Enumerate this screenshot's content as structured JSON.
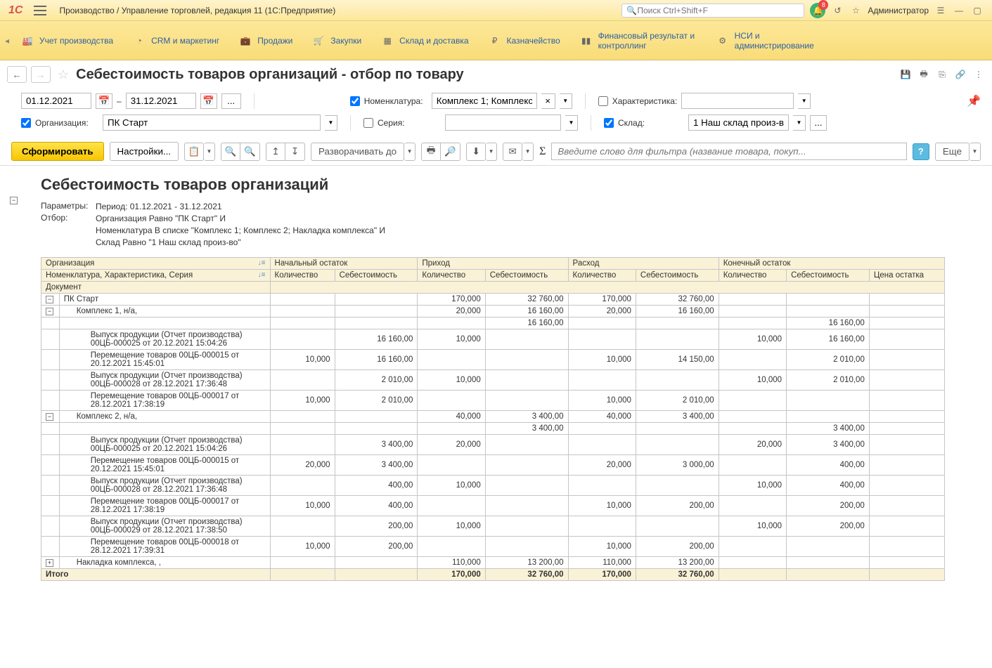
{
  "app": {
    "logo": "1C",
    "title": "Производство / Управление торговлей, редакция 11  (1С:Предприятие)",
    "search_placeholder": "Поиск Ctrl+Shift+F",
    "notification_count": "8",
    "user": "Администратор"
  },
  "sections": [
    {
      "label": "Учет производства"
    },
    {
      "label": "CRM и маркетинг"
    },
    {
      "label": "Продажи"
    },
    {
      "label": "Закупки"
    },
    {
      "label": "Склад и доставка"
    },
    {
      "label": "Казначейство"
    },
    {
      "label": "Финансовый результат и контроллинг"
    },
    {
      "label": "НСИ и администрирование"
    }
  ],
  "page": {
    "title": "Себестоимость товаров организаций - отбор по товару"
  },
  "filters": {
    "date_from": "01.12.2021",
    "date_sep": "–",
    "date_to": "31.12.2021",
    "dots": "...",
    "nomenclature_label": "Номенклатура:",
    "nomenclature_value": "Комплекс 1; Комплекс",
    "characteristic_label": "Характеристика:",
    "org_label": "Организация:",
    "org_value": "ПК Старт",
    "series_label": "Серия:",
    "warehouse_label": "Склад:",
    "warehouse_value": "1 Наш склад произ-во",
    "wh_dots": "..."
  },
  "toolbar": {
    "form": "Сформировать",
    "settings": "Настройки...",
    "expand_to": "Разворачивать до",
    "filter_placeholder": "Введите слово для фильтра (название товара, покуп...",
    "more": "Еще",
    "help": "?"
  },
  "report": {
    "title": "Себестоимость товаров организаций",
    "params_label": "Параметры:",
    "filter_label": "Отбор:",
    "params_line": "Период: 01.12.2021 - 31.12.2021",
    "filter_l1": "Организация Равно \"ПК Старт\" И",
    "filter_l2": "Номенклатура В списке \"Комплекс 1; Комплекс 2; Накладка комплекса\" И",
    "filter_l3": "Склад Равно \"1 Наш склад произ-во\""
  },
  "cols": {
    "h1_org": "Организация",
    "h1_begin": "Начальный остаток",
    "h1_in": "Приход",
    "h1_out": "Расход",
    "h1_end": "Конечный остаток",
    "h2_nomen": "Номенклатура, Характеристика, Серия",
    "h2_qty": "Количество",
    "h2_cost": "Себестоимость",
    "h2_price": "Цена остатка",
    "h3_doc": "Документ"
  },
  "rows": [
    {
      "lvl": 0,
      "toggle": "-",
      "name": "ПК Старт",
      "in_q": "170,000",
      "in_c": "32 760,00",
      "out_q": "170,000",
      "out_c": "32 760,00"
    },
    {
      "lvl": 1,
      "toggle": "-",
      "name": "Комплекс 1, н/а,",
      "in_q": "20,000",
      "in_c": "16 160,00",
      "out_q": "20,000",
      "out_c": "16 160,00"
    },
    {
      "lvl": 2,
      "name": "",
      "in_c": "16 160,00",
      "end_c": "16 160,00"
    },
    {
      "lvl": 2,
      "name": "Выпуск продукции (Отчет производства) 00ЦБ-000025 от 20.12.2021 15:04:26",
      "b_c": "16 160,00",
      "in_q": "10,000",
      "end_q": "10,000",
      "end_c": "16 160,00"
    },
    {
      "lvl": 2,
      "name": "Перемещение товаров 00ЦБ-000015 от 20.12.2021 15:45:01",
      "b_q": "10,000",
      "b_c": "16 160,00",
      "out_q": "10,000",
      "out_c": "14 150,00",
      "end_c": "2 010,00"
    },
    {
      "lvl": 2,
      "name": "Выпуск продукции (Отчет производства) 00ЦБ-000028 от 28.12.2021 17:36:48",
      "b_c": "2 010,00",
      "in_q": "10,000",
      "end_q": "10,000",
      "end_c": "2 010,00"
    },
    {
      "lvl": 2,
      "name": "Перемещение товаров 00ЦБ-000017 от 28.12.2021 17:38:19",
      "b_q": "10,000",
      "b_c": "2 010,00",
      "out_q": "10,000",
      "out_c": "2 010,00"
    },
    {
      "lvl": 1,
      "toggle": "-",
      "name": "Комплекс 2, н/а,",
      "in_q": "40,000",
      "in_c": "3 400,00",
      "out_q": "40,000",
      "out_c": "3 400,00"
    },
    {
      "lvl": 2,
      "name": "",
      "in_c": "3 400,00",
      "end_c": "3 400,00"
    },
    {
      "lvl": 2,
      "name": "Выпуск продукции (Отчет производства) 00ЦБ-000025 от 20.12.2021 15:04:26",
      "b_c": "3 400,00",
      "in_q": "20,000",
      "end_q": "20,000",
      "end_c": "3 400,00"
    },
    {
      "lvl": 2,
      "name": "Перемещение товаров 00ЦБ-000015 от 20.12.2021 15:45:01",
      "b_q": "20,000",
      "b_c": "3 400,00",
      "out_q": "20,000",
      "out_c": "3 000,00",
      "end_c": "400,00"
    },
    {
      "lvl": 2,
      "name": "Выпуск продукции (Отчет производства) 00ЦБ-000028 от 28.12.2021 17:36:48",
      "b_c": "400,00",
      "in_q": "10,000",
      "end_q": "10,000",
      "end_c": "400,00"
    },
    {
      "lvl": 2,
      "name": "Перемещение товаров 00ЦБ-000017 от 28.12.2021 17:38:19",
      "b_q": "10,000",
      "b_c": "400,00",
      "out_q": "10,000",
      "out_c": "200,00",
      "end_c": "200,00"
    },
    {
      "lvl": 2,
      "name": "Выпуск продукции (Отчет производства) 00ЦБ-000029 от 28.12.2021 17:38:50",
      "b_c": "200,00",
      "in_q": "10,000",
      "end_q": "10,000",
      "end_c": "200,00"
    },
    {
      "lvl": 2,
      "name": "Перемещение товаров 00ЦБ-000018 от 28.12.2021 17:39:31",
      "b_q": "10,000",
      "b_c": "200,00",
      "out_q": "10,000",
      "out_c": "200,00"
    },
    {
      "lvl": 1,
      "toggle": "+",
      "name": "Накладка комплекса, ,",
      "in_q": "110,000",
      "in_c": "13 200,00",
      "out_q": "110,000",
      "out_c": "13 200,00"
    }
  ],
  "totals": {
    "label": "Итого",
    "in_q": "170,000",
    "in_c": "32 760,00",
    "out_q": "170,000",
    "out_c": "32 760,00"
  }
}
